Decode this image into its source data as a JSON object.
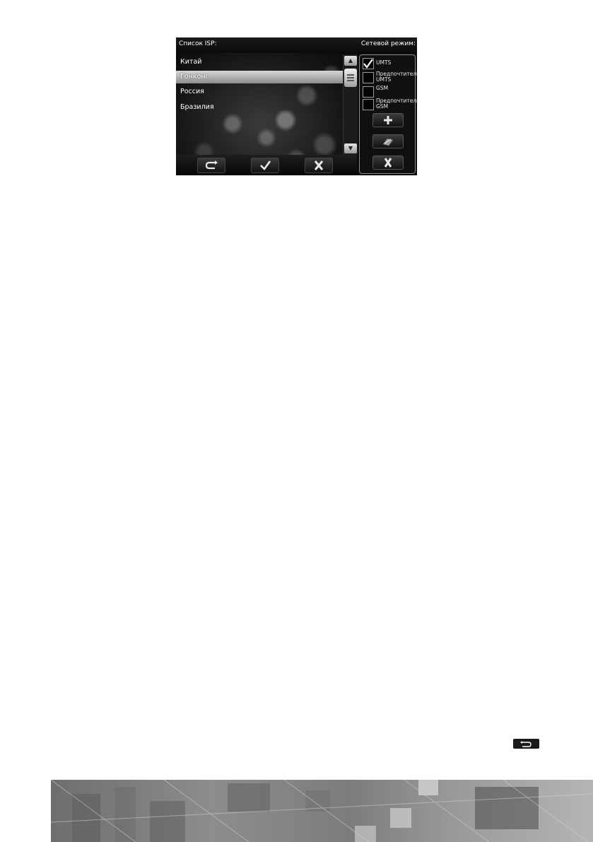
{
  "header": {
    "isp_title": "Список ISP:",
    "mode_title": "Сетевой режим:"
  },
  "isp_list": {
    "items": [
      {
        "label": "Китай",
        "selected": false
      },
      {
        "label": "Гонконг",
        "selected": true
      },
      {
        "label": "Россия",
        "selected": false
      },
      {
        "label": "Бразилия",
        "selected": false
      }
    ]
  },
  "network_modes": {
    "options": [
      {
        "label": "UMTS",
        "checked": true
      },
      {
        "label": "Предпочтительные UMTS",
        "checked": false
      },
      {
        "label": "GSM",
        "checked": false
      },
      {
        "label": "Предпочтительные GSM",
        "checked": false
      }
    ]
  },
  "icons": {
    "scroll_up": "arrow-up-icon",
    "scroll_down": "arrow-down-icon",
    "refresh": "refresh-icon",
    "confirm": "checkmark-icon",
    "cancel": "close-icon",
    "add": "plus-icon",
    "edit": "edit-icon",
    "delete": "delete-icon",
    "inline": "return-icon"
  },
  "colors": {
    "screen_bg": "#0b0b0b",
    "selected_row": "#b0b0b0",
    "text": "#ffffff"
  }
}
